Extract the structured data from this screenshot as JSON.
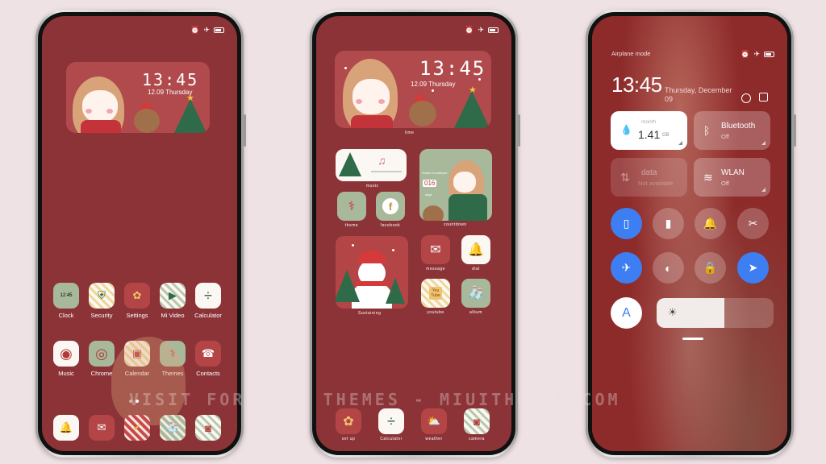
{
  "watermark": "VISIT FOR MORE THEMES - MIUITHEMER.COM",
  "colors": {
    "wallpaper": "#8c3337",
    "accent_blue": "#3d7ef2",
    "page_bg": "#efe2e4"
  },
  "status_icons": [
    "alarm-icon",
    "airplane-icon",
    "battery-icon"
  ],
  "phone1": {
    "clock_widget": {
      "time": "13:45",
      "date": "12.09 Thursday"
    },
    "apps_row1": [
      {
        "label": "Clock",
        "icon": "clock-icon",
        "glyph": "12:45"
      },
      {
        "label": "Security",
        "icon": "shield-icon",
        "glyph": "⛨"
      },
      {
        "label": "Settings",
        "icon": "gear-icon",
        "glyph": "✿"
      },
      {
        "label": "Mi Video",
        "icon": "play-icon",
        "glyph": "▶"
      },
      {
        "label": "Calculator",
        "icon": "calculator-icon",
        "glyph": "÷"
      }
    ],
    "apps_row2": [
      {
        "label": "Music",
        "icon": "music-icon",
        "glyph": "◉"
      },
      {
        "label": "Chrome",
        "icon": "chrome-icon",
        "glyph": "◎"
      },
      {
        "label": "Calendar",
        "icon": "calendar-icon",
        "glyph": "▣"
      },
      {
        "label": "Themes",
        "icon": "candy-cane-icon",
        "glyph": "⚕"
      },
      {
        "label": "Contacts",
        "icon": "contacts-icon",
        "glyph": "☎"
      }
    ],
    "dock": [
      {
        "icon": "bell-icon",
        "glyph": "🔔"
      },
      {
        "icon": "message-icon",
        "glyph": "✉"
      },
      {
        "icon": "gift-icon",
        "glyph": "✔"
      },
      {
        "icon": "stocking-icon",
        "glyph": "🧦"
      },
      {
        "icon": "camera-icon",
        "glyph": "◙"
      }
    ]
  },
  "phone2": {
    "clock_widget": {
      "time": "13:45",
      "date": "12.09 Thursday",
      "label": "time"
    },
    "music_widget": {
      "label": "music",
      "note": "♫"
    },
    "countdown_widget": {
      "label": "countdown",
      "value": "016",
      "caption": "Xmas Countdown",
      "unit": "days"
    },
    "snowman_widget": {
      "label": "Sustaining"
    },
    "apps": [
      {
        "label": "theme",
        "icon": "candy-cane-icon",
        "glyph": "⚕"
      },
      {
        "label": "facebook",
        "icon": "facebook-icon",
        "glyph": "f"
      },
      {
        "label": "message",
        "icon": "message-icon",
        "glyph": "✉"
      },
      {
        "label": "dial",
        "icon": "bell-icon",
        "glyph": "🔔"
      },
      {
        "label": "youtube",
        "icon": "youtube-icon",
        "glyph": "You Tube"
      },
      {
        "label": "album",
        "icon": "stocking-icon",
        "glyph": "🧦"
      }
    ],
    "dock": [
      {
        "label": "set up",
        "icon": "gear-icon",
        "glyph": "✿"
      },
      {
        "label": "Calculator",
        "icon": "calculator-icon",
        "glyph": "÷"
      },
      {
        "label": "weather",
        "icon": "weather-icon",
        "glyph": "⛅"
      },
      {
        "label": "camera",
        "icon": "camera-icon",
        "glyph": "◙"
      }
    ]
  },
  "phone3": {
    "mode": "Airplane mode",
    "time": "13:45",
    "date": "Thursday, December 09",
    "tiles": [
      {
        "title": "1.41",
        "unit": "GB",
        "subtitle": "month",
        "icon": "water-drop-icon",
        "glyph": "💧",
        "state": "on"
      },
      {
        "title": "Bluetooth",
        "subtitle": "Off",
        "icon": "bluetooth-icon",
        "glyph": "ᛒ",
        "state": "off"
      },
      {
        "title": "data",
        "subtitle": "Not available",
        "icon": "mobile-data-icon",
        "glyph": "⇅",
        "state": "disabled"
      },
      {
        "title": "WLAN",
        "subtitle": "Off",
        "icon": "wifi-icon",
        "glyph": "≋",
        "state": "off"
      }
    ],
    "toggles": [
      {
        "name": "vibrate",
        "glyph": "▯",
        "active": true
      },
      {
        "name": "flashlight",
        "glyph": "▮",
        "active": false
      },
      {
        "name": "silent",
        "glyph": "🔔",
        "active": false
      },
      {
        "name": "screenshot",
        "glyph": "✂",
        "active": false
      },
      {
        "name": "airplane",
        "glyph": "✈",
        "active": true
      },
      {
        "name": "dark-mode",
        "glyph": "◐",
        "active": false
      },
      {
        "name": "rotation-lock",
        "glyph": "🔒",
        "active": false
      },
      {
        "name": "location",
        "glyph": "➤",
        "active": true
      }
    ],
    "auto_brightness": "A",
    "brightness_percent": 58
  }
}
